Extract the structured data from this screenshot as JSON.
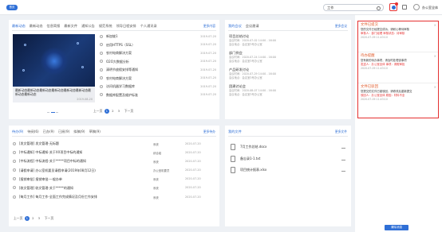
{
  "header": {
    "logo_label": "首页",
    "search_value": "工作",
    "user_name": "办公室全体"
  },
  "news": {
    "tabs": [
      "最新动态",
      "最新动态",
      "信息简报",
      "最新文件",
      "通知公告",
      "规范系统",
      "领导日程安排",
      "个人通讯录"
    ],
    "more_label": "更多内容",
    "feature_caption": "最新动态最新动态最新动态最新动态最新动态最新动态最新动态最新动态",
    "feature_date": "2019-08-20",
    "items": [
      {
        "title": "新加坡1",
        "date": "2019-07-20"
      },
      {
        "title": "启用HTTPS（SSL）",
        "date": "2019-07-20"
      },
      {
        "title": "农村电商解决方案",
        "date": "2019-07-20"
      },
      {
        "title": "O2O大数据分析",
        "date": "2019-07-20"
      },
      {
        "title": "清明节放假安排等通知",
        "date": "2019-07-20"
      },
      {
        "title": "农村电商解决方案",
        "date": "2019-07-20"
      },
      {
        "title": "访问机器学习数据库",
        "date": "2019-07-20"
      },
      {
        "title": "数据库配置及维护标准",
        "date": "2019-07-20"
      }
    ],
    "pager": {
      "prev": "上一页",
      "pages": [
        "1",
        "2",
        "3"
      ],
      "next": "下一页"
    }
  },
  "meetings": {
    "tabs": [
      "我的会议",
      "会议邀请"
    ],
    "more_label": "更多会议",
    "items": [
      {
        "title": "项目总结讨论",
        "time": "会议时间：2020-07-02 14:00 - 16:00",
        "place": "会议地点：会议室3号办公室"
      },
      {
        "title": "部门例会",
        "time": "会议时间：2020-07-24 14:00 - 16:00",
        "place": "会议地点：会议室3号办公室"
      },
      {
        "title": "产品研发讨论",
        "time": "会议时间：2020-07-29 14:00 - 16:00",
        "place": "会议地点：会议室3号办公室"
      },
      {
        "title": "团建讨论会",
        "time": "会议时间：2020-08-07 14:00 - 16:00",
        "place": "会议地点：会议室3号办公室"
      }
    ]
  },
  "todos": {
    "tabs": [
      "待办(9)",
      "待阅(6)",
      "已办(9)",
      "已阅(9)",
      "拟稿(9)",
      "草稿(9)"
    ],
    "more_label": "更多待办",
    "rows": [
      {
        "title": "[发文管理] 发文管理-无标题",
        "person": "系统",
        "date": "2020-07-20"
      },
      {
        "title": "[中标通知] 中标通知-关于XX项目中标的通知",
        "person": "综合组",
        "date": "2020-07-20"
      },
      {
        "title": "[中标流程] 中标流程-关于*****项目中标的通知",
        "person": "系统",
        "date": "2020-07-20"
      },
      {
        "title": "[请假申请] 办公室机要员请假申请(2019年08月12日)",
        "person": "办公室机要员",
        "date": "2020-07-20"
      },
      {
        "title": "[报销审批] 报销审批-一般办单",
        "person": "系统",
        "date": "2020-07-20"
      },
      {
        "title": "[收文管理] 收文管理-关于*****的通知",
        "person": "系统",
        "date": "2020-07-20"
      },
      {
        "title": "[每月工作] 每月工作-全面工作完成情况及月份工作安排",
        "person": "系统",
        "date": "2020-07-20"
      }
    ],
    "pager": {
      "prev": "上一页",
      "pages": [
        "1",
        "2",
        "3"
      ],
      "next": "下一页"
    }
  },
  "documents": {
    "tab": "我的文件",
    "more_label": "更多文件",
    "files": [
      {
        "name": "7月工作总结.docx"
      },
      {
        "name": "备忘录1-1.txt"
      },
      {
        "name": "项目统计报表.xlsx"
      }
    ]
  },
  "notices": {
    "items": [
      {
        "heading": "文件已提交",
        "line1": "您的文件已经提交成功，请耐心等待审核",
        "line2": "审核人：部门经理  审核状态：待审核",
        "meta": "2020-07-09 11:43:10"
      },
      {
        "heading": "待办提醒",
        "line1": "您有新的待办事项，请及时处理该事项",
        "line2": "发送人：办公室全体  事项：请假审批",
        "meta": "2020-07-09 11:43:10"
      },
      {
        "heading": "文件已驳回",
        "line1": "您提交的文件已被驳回，请修改后重新提交",
        "line2": "驳回人：办公室全体  原因：材料不全",
        "meta": "2020-07-09 11:43:10"
      }
    ],
    "clear_label": "清除消息"
  },
  "colors": {
    "accent": "#2f6fd6",
    "alert": "#e53030",
    "notice_heading": "#e05a2a"
  }
}
